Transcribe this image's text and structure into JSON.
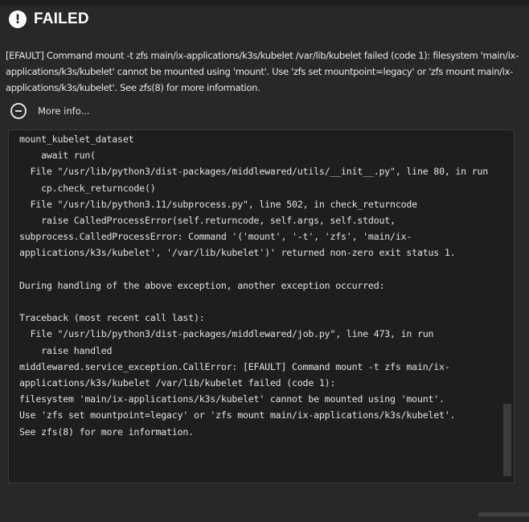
{
  "dialog": {
    "title": "FAILED",
    "icon": "error-icon",
    "error_glyph": "!",
    "message": "[EFAULT] Command mount -t zfs main/ix-applications/k3s/kubelet /var/lib/kubelet failed (code 1): filesystem 'main/ix-applications/k3s/kubelet' cannot be mounted using 'mount'. Use 'zfs set mountpoint=legacy' or 'zfs mount main/ix-applications/k3s/kubelet'. See zfs(8) for more information.",
    "more_info_label": "More info...",
    "more_info_icon": "minus-circle-icon",
    "traceback": "mount_kubelet_dataset\n    await run(\n  File \"/usr/lib/python3/dist-packages/middlewared/utils/__init__.py\", line 80, in run\n    cp.check_returncode()\n  File \"/usr/lib/python3.11/subprocess.py\", line 502, in check_returncode\n    raise CalledProcessError(self.returncode, self.args, self.stdout,\nsubprocess.CalledProcessError: Command '('mount', '-t', 'zfs', 'main/ix-applications/k3s/kubelet', '/var/lib/kubelet')' returned non-zero exit status 1.\n\nDuring handling of the above exception, another exception occurred:\n\nTraceback (most recent call last):\n  File \"/usr/lib/python3/dist-packages/middlewared/job.py\", line 473, in run\n    raise handled\nmiddlewared.service_exception.CallError: [EFAULT] Command mount -t zfs main/ix-applications/k3s/kubelet /var/lib/kubelet failed (code 1):\nfilesystem 'main/ix-applications/k3s/kubelet' cannot be mounted using 'mount'.\nUse 'zfs set mountpoint=legacy' or 'zfs mount main/ix-applications/k3s/kubelet'.\nSee zfs(8) for more information."
  },
  "colors": {
    "background": "#282828",
    "trace_background": "#1e1e1e",
    "text": "#e4e4e4"
  }
}
